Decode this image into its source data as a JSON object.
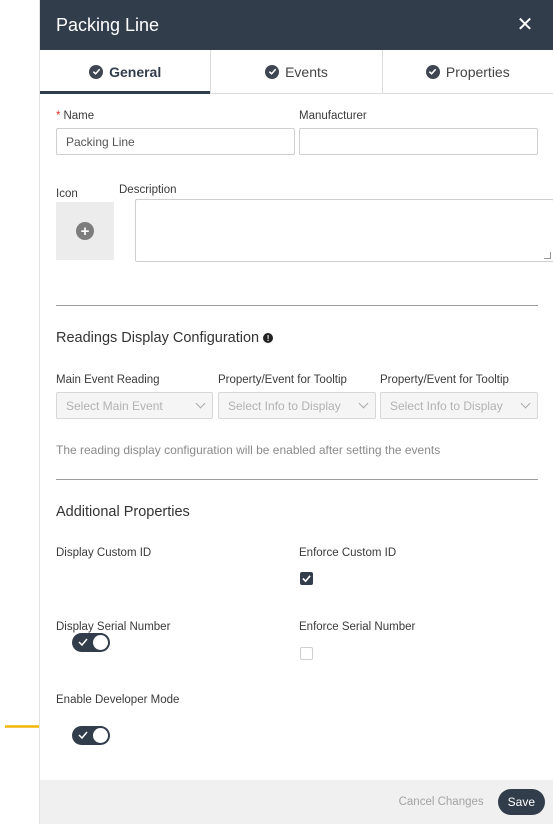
{
  "header": {
    "title": "Packing Line",
    "close_glyph": "✕"
  },
  "tabs": [
    {
      "label": "General",
      "active": true,
      "icon": "check-circle-icon"
    },
    {
      "label": "Events",
      "active": false,
      "icon": "check-circle-icon"
    },
    {
      "label": "Properties",
      "active": false,
      "icon": "check-circle-icon"
    }
  ],
  "form": {
    "required_mark": "*",
    "name_label": "Name",
    "name_value": "Packing Line",
    "manufacturer_label": "Manufacturer",
    "manufacturer_value": "",
    "icon_label": "Icon",
    "icon_add_glyph": "+",
    "description_label": "Description",
    "description_value": ""
  },
  "readings": {
    "title": "Readings Display Configuration",
    "info_glyph": "!",
    "main_event_label": "Main Event Reading",
    "main_event_placeholder": "Select Main Event",
    "tooltip1_label": "Property/Event for Tooltip",
    "tooltip1_placeholder": "Select Info to Display",
    "tooltip2_label": "Property/Event for Tooltip",
    "tooltip2_placeholder": "Select Info to Display",
    "note": "The reading display configuration will be enabled after setting the events"
  },
  "additional": {
    "title": "Additional Properties",
    "display_custom_id_label": "Display Custom ID",
    "display_custom_id_on": true,
    "enforce_custom_id_label": "Enforce Custom ID",
    "enforce_custom_id_checked": true,
    "display_serial_label": "Display Serial Number",
    "display_serial_on": true,
    "enforce_serial_label": "Enforce Serial Number",
    "enforce_serial_checked": false,
    "developer_mode_label": "Enable Developer Mode",
    "developer_mode_on": true
  },
  "footer": {
    "cancel_label": "Cancel Changes",
    "save_label": "Save"
  },
  "colors": {
    "primary": "#323d4c",
    "required": "#d9342b",
    "annotation_arrow": "#f2b705"
  }
}
